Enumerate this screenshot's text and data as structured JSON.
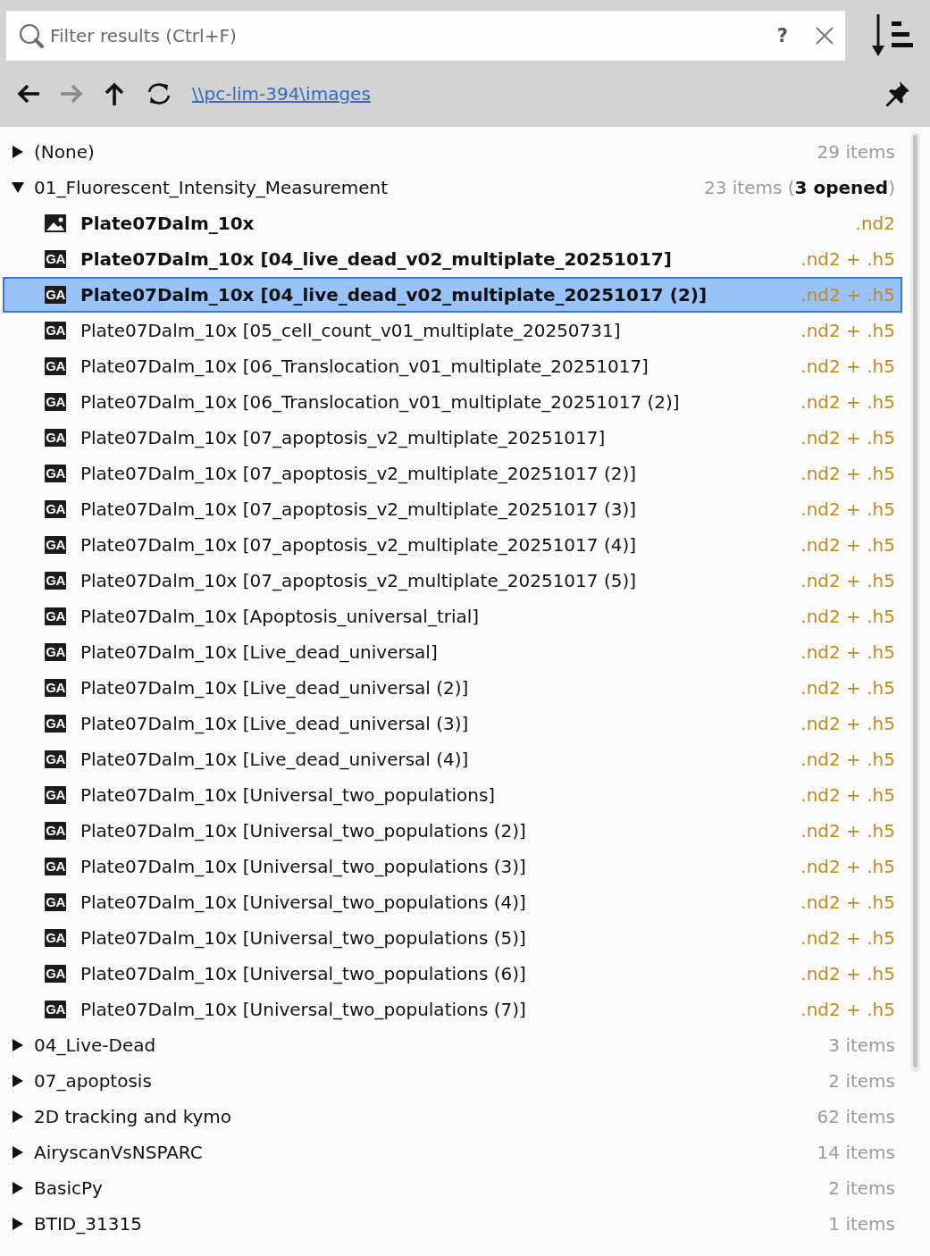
{
  "search": {
    "placeholder": "Filter results (Ctrl+F)",
    "help": "?"
  },
  "toolbar": {
    "nav": [
      {
        "kind": "back",
        "disabled": false
      },
      {
        "kind": "forward",
        "disabled": true
      },
      {
        "kind": "up",
        "disabled": false
      },
      {
        "kind": "refresh",
        "disabled": false
      }
    ],
    "path": "\\\\pc-lim-394\\images"
  },
  "tree": [
    {
      "kind": "folder",
      "name": "(None)",
      "count": "29 items",
      "expanded": false,
      "selected": false
    },
    {
      "kind": "folder",
      "name": "01_Fluorescent_Intensity_Measurement",
      "count": "23 items (**3 opened**)",
      "expanded": true,
      "selected": false,
      "children": [
        {
          "kind": "image",
          "name": "Plate07Dalm_10x",
          "files": ".nd2",
          "opened": true,
          "selected": false
        },
        {
          "kind": "analysis",
          "badge": "GA",
          "name": "Plate07Dalm_10x [04_live_dead_v02_multiplate_20251017]",
          "files": ".nd2 + .h5",
          "opened": true,
          "selected": false
        },
        {
          "kind": "analysis",
          "badge": "GA",
          "name": "Plate07Dalm_10x [04_live_dead_v02_multiplate_20251017 (2)]",
          "files": ".nd2 + .h5",
          "opened": true,
          "selected": true
        },
        {
          "kind": "analysis",
          "badge": "GA",
          "name": "Plate07Dalm_10x [05_cell_count_v01_multiplate_20250731]",
          "files": ".nd2 + .h5",
          "opened": false,
          "selected": false
        },
        {
          "kind": "analysis",
          "badge": "GA",
          "name": "Plate07Dalm_10x [06_Translocation_v01_multiplate_20251017]",
          "files": ".nd2 + .h5",
          "opened": false,
          "selected": false
        },
        {
          "kind": "analysis",
          "badge": "GA",
          "name": "Plate07Dalm_10x [06_Translocation_v01_multiplate_20251017 (2)]",
          "files": ".nd2 + .h5",
          "opened": false,
          "selected": false
        },
        {
          "kind": "analysis",
          "badge": "GA",
          "name": "Plate07Dalm_10x [07_apoptosis_v2_multiplate_20251017]",
          "files": ".nd2 + .h5",
          "opened": false,
          "selected": false
        },
        {
          "kind": "analysis",
          "badge": "GA",
          "name": "Plate07Dalm_10x [07_apoptosis_v2_multiplate_20251017 (2)]",
          "files": ".nd2 + .h5",
          "opened": false,
          "selected": false
        },
        {
          "kind": "analysis",
          "badge": "GA",
          "name": "Plate07Dalm_10x [07_apoptosis_v2_multiplate_20251017 (3)]",
          "files": ".nd2 + .h5",
          "opened": false,
          "selected": false
        },
        {
          "kind": "analysis",
          "badge": "GA",
          "name": "Plate07Dalm_10x [07_apoptosis_v2_multiplate_20251017 (4)]",
          "files": ".nd2 + .h5",
          "opened": false,
          "selected": false
        },
        {
          "kind": "analysis",
          "badge": "GA",
          "name": "Plate07Dalm_10x [07_apoptosis_v2_multiplate_20251017 (5)]",
          "files": ".nd2 + .h5",
          "opened": false,
          "selected": false
        },
        {
          "kind": "analysis",
          "badge": "GA",
          "name": "Plate07Dalm_10x [Apoptosis_universal_trial]",
          "files": ".nd2 + .h5",
          "opened": false,
          "selected": false
        },
        {
          "kind": "analysis",
          "badge": "GA",
          "name": "Plate07Dalm_10x [Live_dead_universal]",
          "files": ".nd2 + .h5",
          "opened": false,
          "selected": false
        },
        {
          "kind": "analysis",
          "badge": "GA",
          "name": "Plate07Dalm_10x [Live_dead_universal (2)]",
          "files": ".nd2 + .h5",
          "opened": false,
          "selected": false
        },
        {
          "kind": "analysis",
          "badge": "GA",
          "name": "Plate07Dalm_10x [Live_dead_universal (3)]",
          "files": ".nd2 + .h5",
          "opened": false,
          "selected": false
        },
        {
          "kind": "analysis",
          "badge": "GA",
          "name": "Plate07Dalm_10x [Live_dead_universal (4)]",
          "files": ".nd2 + .h5",
          "opened": false,
          "selected": false
        },
        {
          "kind": "analysis",
          "badge": "GA",
          "name": "Plate07Dalm_10x [Universal_two_populations]",
          "files": ".nd2 + .h5",
          "opened": false,
          "selected": false
        },
        {
          "kind": "analysis",
          "badge": "GA",
          "name": "Plate07Dalm_10x [Universal_two_populations (2)]",
          "files": ".nd2 + .h5",
          "opened": false,
          "selected": false
        },
        {
          "kind": "analysis",
          "badge": "GA",
          "name": "Plate07Dalm_10x [Universal_two_populations (3)]",
          "files": ".nd2 + .h5",
          "opened": false,
          "selected": false
        },
        {
          "kind": "analysis",
          "badge": "GA",
          "name": "Plate07Dalm_10x [Universal_two_populations (4)]",
          "files": ".nd2 + .h5",
          "opened": false,
          "selected": false
        },
        {
          "kind": "analysis",
          "badge": "GA",
          "name": "Plate07Dalm_10x [Universal_two_populations (5)]",
          "files": ".nd2 + .h5",
          "opened": false,
          "selected": false
        },
        {
          "kind": "analysis",
          "badge": "GA",
          "name": "Plate07Dalm_10x [Universal_two_populations (6)]",
          "files": ".nd2 + .h5",
          "opened": false,
          "selected": false
        },
        {
          "kind": "analysis",
          "badge": "GA",
          "name": "Plate07Dalm_10x [Universal_two_populations (7)]",
          "files": ".nd2 + .h5",
          "opened": false,
          "selected": false
        }
      ]
    },
    {
      "kind": "folder",
      "name": "04_Live-Dead",
      "count": "3 items",
      "expanded": false,
      "selected": false
    },
    {
      "kind": "folder",
      "name": "07_apoptosis",
      "count": "2 items",
      "expanded": false,
      "selected": false
    },
    {
      "kind": "folder",
      "name": "2D tracking and kymo",
      "count": "62 items",
      "expanded": false,
      "selected": false
    },
    {
      "kind": "folder",
      "name": "AiryscanVsNSPARC",
      "count": "14 items",
      "expanded": false,
      "selected": false
    },
    {
      "kind": "folder",
      "name": "BasicPy",
      "count": "2 items",
      "expanded": false,
      "selected": false
    },
    {
      "kind": "folder",
      "name": "BTID_31315",
      "count": "1 items",
      "expanded": false,
      "selected": false
    }
  ]
}
